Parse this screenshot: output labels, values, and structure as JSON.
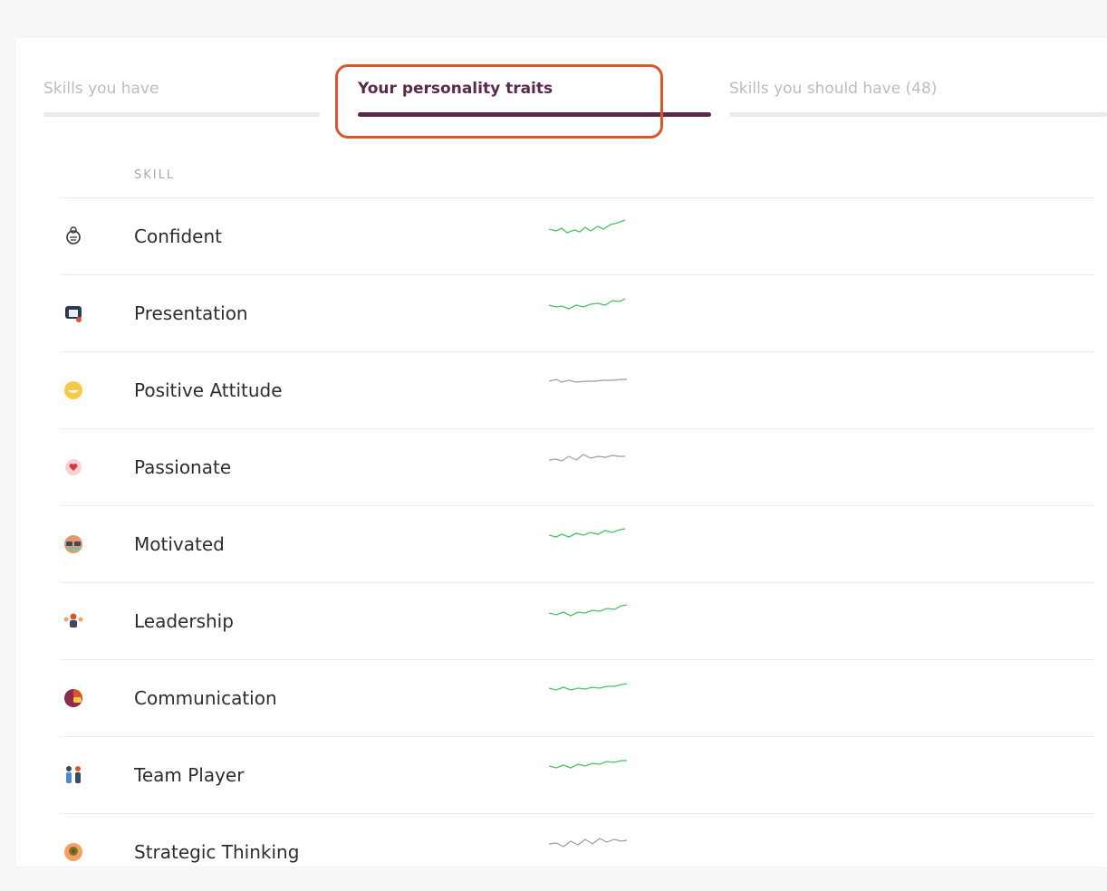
{
  "tabs": [
    {
      "label": "Skills you have",
      "active": false
    },
    {
      "label": "Your personality traits",
      "active": true
    },
    {
      "label": "Skills you should have (48)",
      "active": false
    }
  ],
  "table": {
    "header_skill": "SKILL",
    "rows": [
      {
        "name": "Confident",
        "icon": "confident-icon",
        "trend_color": "#4cbf6b"
      },
      {
        "name": "Presentation",
        "icon": "presentation-icon",
        "trend_color": "#4cbf6b"
      },
      {
        "name": "Positive Attitude",
        "icon": "smiley-icon",
        "trend_color": "#9a9da5"
      },
      {
        "name": "Passionate",
        "icon": "heart-icon",
        "trend_color": "#9a9da5"
      },
      {
        "name": "Motivated",
        "icon": "motivated-icon",
        "trend_color": "#4cbf6b"
      },
      {
        "name": "Leadership",
        "icon": "leadership-icon",
        "trend_color": "#4cbf6b"
      },
      {
        "name": "Communication",
        "icon": "communication-icon",
        "trend_color": "#4cbf6b"
      },
      {
        "name": "Team Player",
        "icon": "team-player-icon",
        "trend_color": "#4cbf6b"
      },
      {
        "name": "Strategic Thinking",
        "icon": "strategy-icon",
        "trend_color": "#9a9da5"
      }
    ]
  },
  "colors": {
    "accent": "#5a2a4b",
    "highlight_box": "#d9572a",
    "trend_up": "#4cbf6b",
    "trend_flat": "#9a9da5"
  }
}
